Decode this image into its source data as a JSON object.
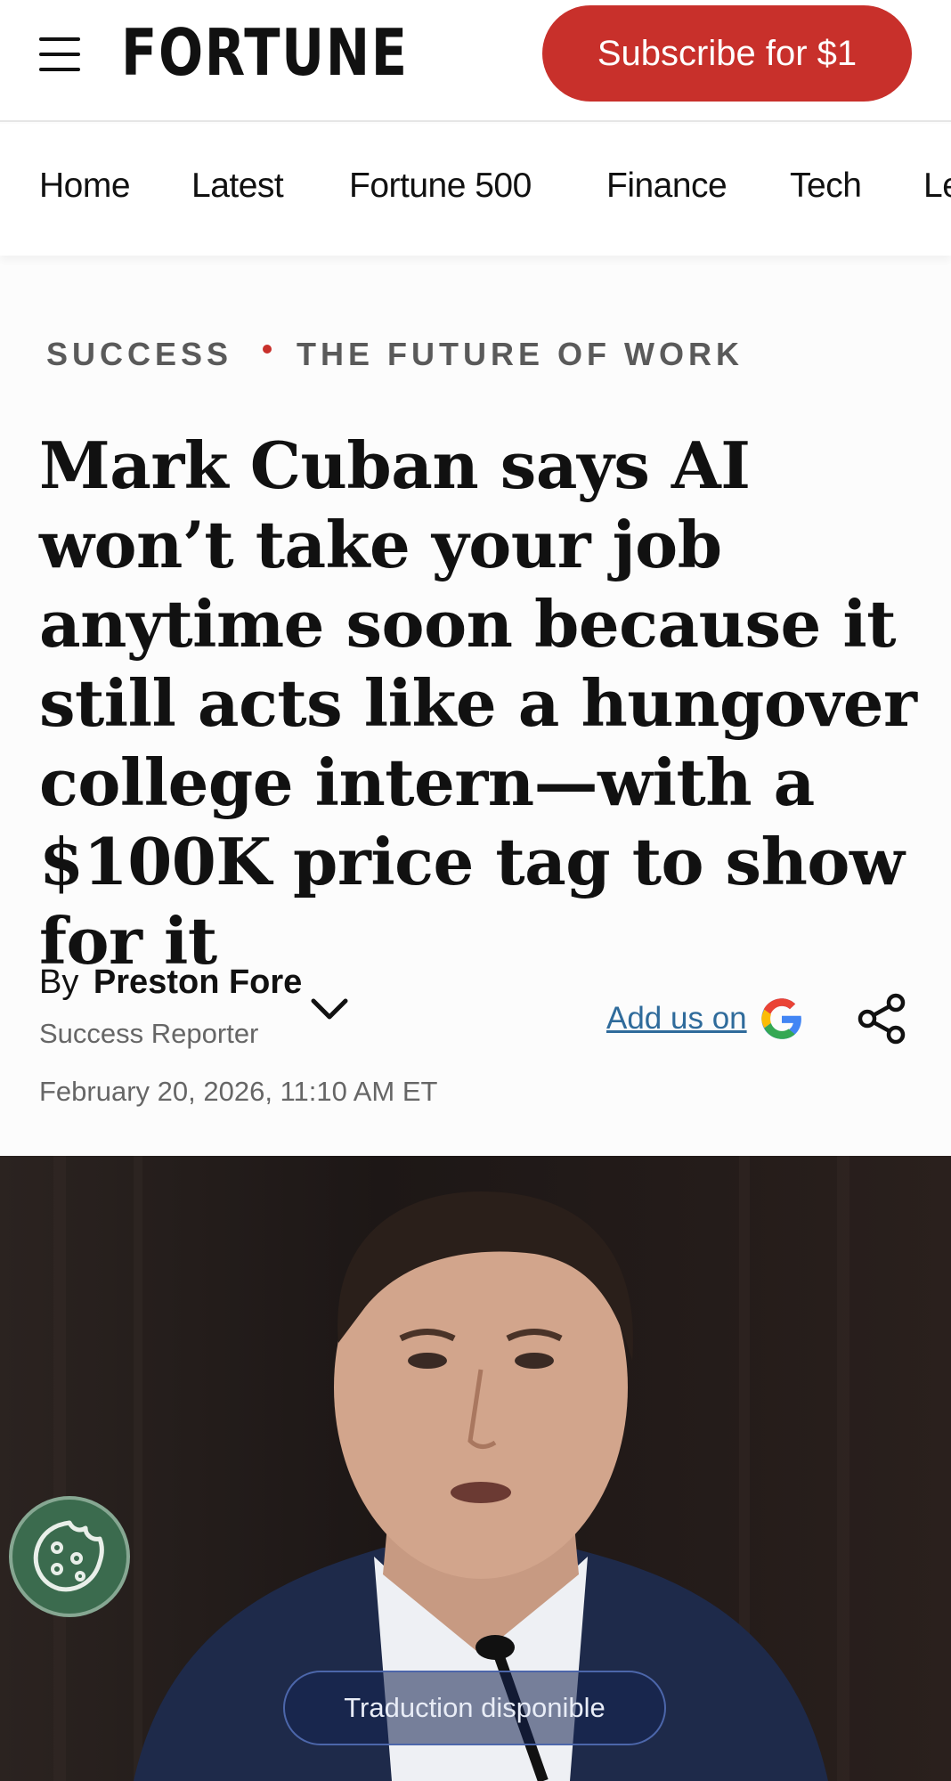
{
  "header": {
    "menu_icon": "hamburger-menu-icon",
    "logo": "FORTUNE",
    "subscribe_label": "Subscribe for $1"
  },
  "nav": {
    "items": [
      "Home",
      "Latest",
      "Fortune 500",
      "Finance",
      "Tech",
      "Le"
    ]
  },
  "article": {
    "section": "SUCCESS",
    "subsection": "THE FUTURE OF WORK",
    "headline": "Mark Cuban says AI won’t take your job anytime soon because it still acts like a hungover college intern—with a $100K price tag to show for it",
    "by": "By",
    "author": "Preston Fore",
    "role": "Success Reporter",
    "date": "February 20, 2026, 11:10 AM ET",
    "add_us_label": "Add us on",
    "google_icon": "google-icon",
    "share_icon": "share-icon"
  },
  "overlay": {
    "cookie_icon": "cookie-icon",
    "translate_label": "Traduction disponible"
  },
  "colors": {
    "accent_red": "#c8302b",
    "link_blue": "#2f6b9b",
    "cookie_green": "#3b6b4e"
  }
}
